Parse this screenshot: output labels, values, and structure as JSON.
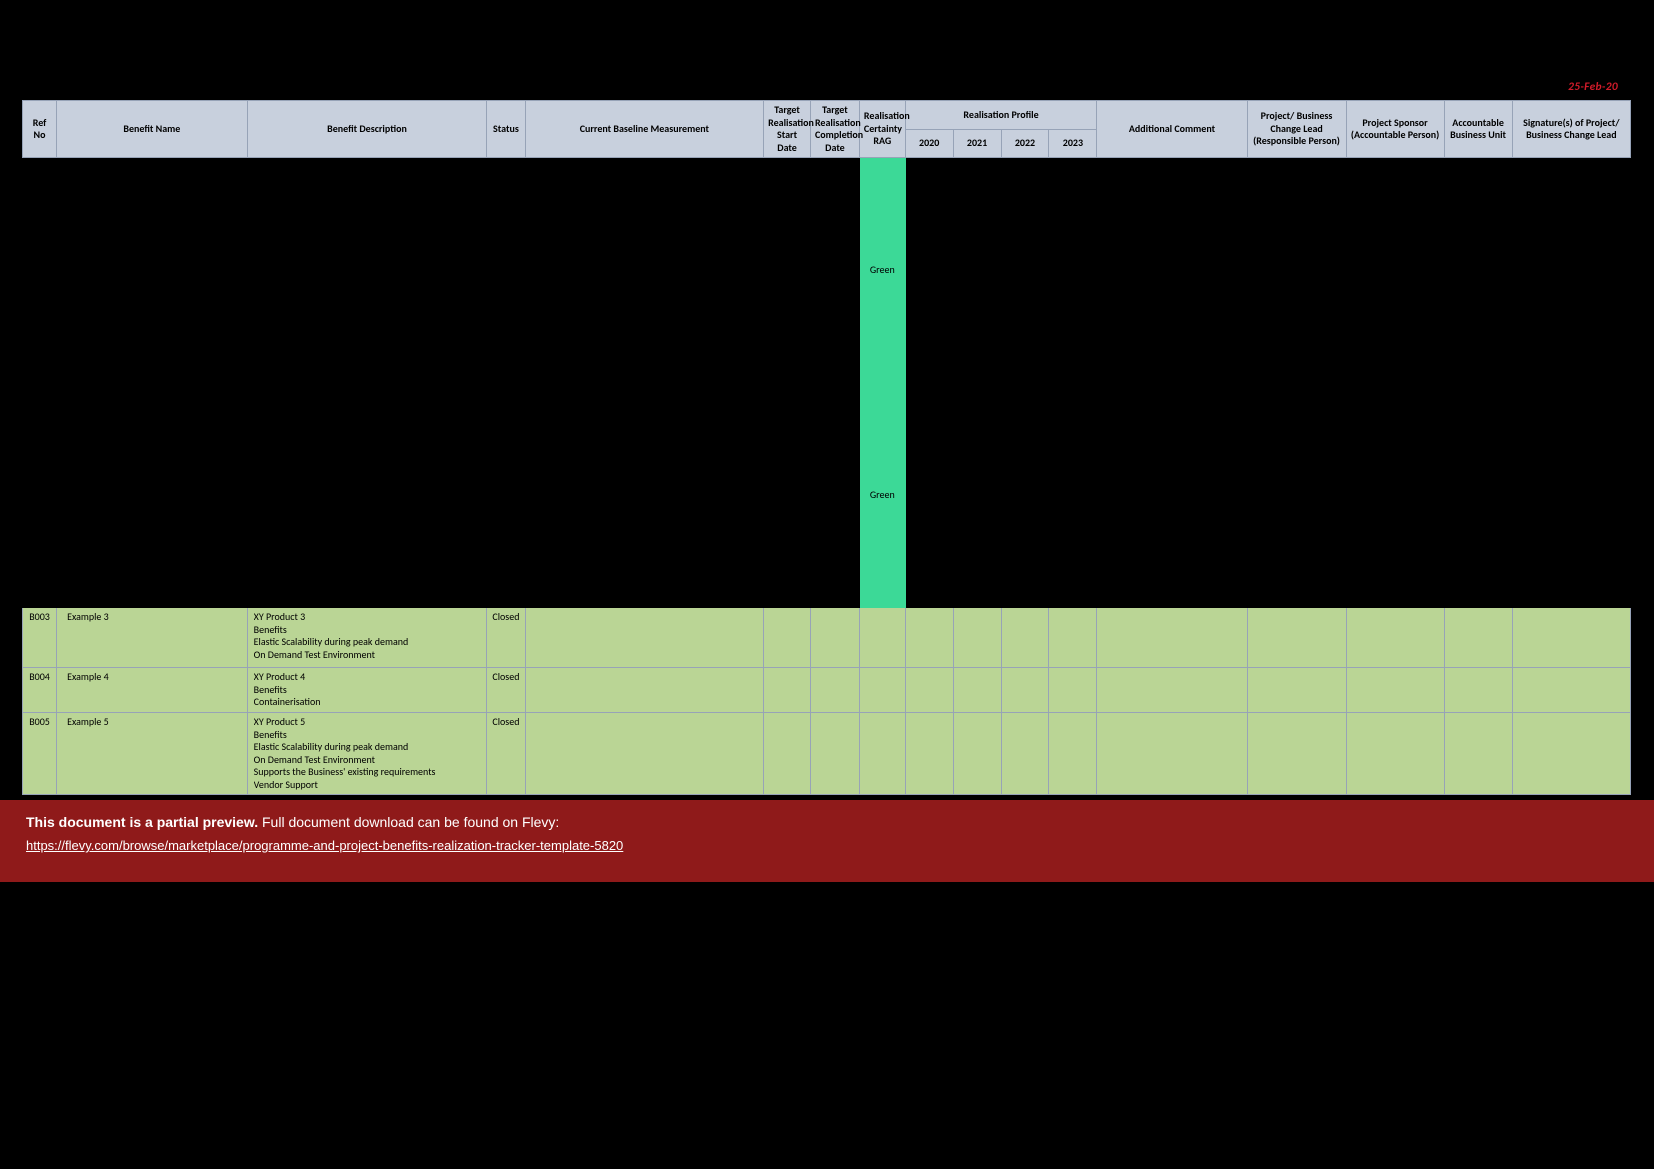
{
  "meta": {
    "date_stamp": "25-Feb-20"
  },
  "headers": {
    "ref": "Ref No",
    "name": "Benefit Name",
    "desc": "Benefit Description",
    "status": "Status",
    "baseline": "Current Baseline Measurement",
    "tgt_start": "Target Realisation Start Date",
    "tgt_comp": "Target Realisation Completion Date",
    "rag": "Realisation Certainty RAG",
    "profile": "Realisation Profile",
    "y2020": "2020",
    "y2021": "2021",
    "y2022": "2022",
    "y2023": "2023",
    "comment": "Additional Comment",
    "lead": "Project/ Business Change Lead (Responsible Person)",
    "sponsor": "Project Sponsor (Accountable Person)",
    "abu": "Accountable Business Unit",
    "sig": "Signature(s) of Project/ Business Change Lead"
  },
  "hidden_rows": [
    {
      "rag": "Green"
    },
    {
      "rag": "Green"
    }
  ],
  "rows": [
    {
      "ref": "B003",
      "name": "Example 3",
      "status": "Closed",
      "desc_lines": [
        "XY Product 3",
        "Benefits",
        "Elastic Scalability during peak demand",
        "On Demand Test Environment"
      ]
    },
    {
      "ref": "B004",
      "name": "Example 4",
      "status": "Closed",
      "desc_lines": [
        "XY Product 4",
        "Benefits",
        "Containerisation"
      ]
    },
    {
      "ref": "B005",
      "name": "Example 5",
      "status": "Closed",
      "desc_lines": [
        "XY Product 5",
        "Benefits",
        "Elastic Scalability during peak demand",
        "On Demand Test Environment",
        "Supports the Business' existing requirements",
        "Vendor Support"
      ]
    }
  ],
  "banner": {
    "bold": "This document is a partial preview.",
    "rest": "  Full document download can be found on Flevy:",
    "link": "https://flevy.com/browse/marketplace/programme-and-project-benefits-realization-tracker-template-5820"
  }
}
